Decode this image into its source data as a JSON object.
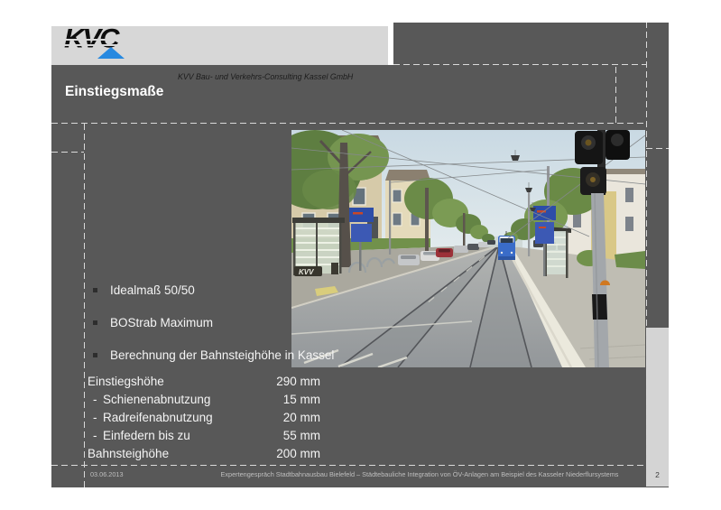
{
  "slide": {
    "header": {
      "logo_text": "KVC",
      "company": "KVV Bau- und Verkehrs-Consulting Kassel GmbH"
    },
    "title": "Einstiegsmaße",
    "bullets": [
      "Idealmaß 50/50",
      "BOStrab Maximum",
      "Berechnung der Bahnsteighöhe in Kassel"
    ],
    "measurements": {
      "rows": [
        {
          "prefix": "",
          "label": "Einstiegshöhe",
          "value": "290 mm"
        },
        {
          "prefix": "-",
          "label": "Schienenabnutzung",
          "value": "15 mm"
        },
        {
          "prefix": "-",
          "label": "Radreifenabnutzung",
          "value": "20 mm"
        },
        {
          "prefix": "-",
          "label": "Einfedern bis zu",
          "value": "55 mm"
        },
        {
          "prefix": "",
          "label": "Bahnsteighöhe",
          "value": "200 mm"
        }
      ]
    },
    "photo": {
      "description": "Straßenansicht einer Stadtbahn-Haltestelle in Kassel: Rasen-/Straßengleis in der Fahrbahn, blaue Niederflurbahn, Bahnsteig mit weißem Leitstreifen, Wartehäuschen, Ampel, parkende Autos, Bäume und Wohnhäuser",
      "shelter_logo": "KVV"
    },
    "footer": {
      "date": "03.06.2013",
      "text": "Expertengespräch Stadtbahnausbau Bielefeld – Städtebauliche Integration von ÖV-Anlagen am Beispiel des Kasseler Niederflursystems",
      "page": "2"
    },
    "colors": {
      "slide_bg": "#585858",
      "band_light": "#d7d7d7",
      "logo_blue": "#2789e0",
      "body_text": "#f4f4f4"
    }
  }
}
